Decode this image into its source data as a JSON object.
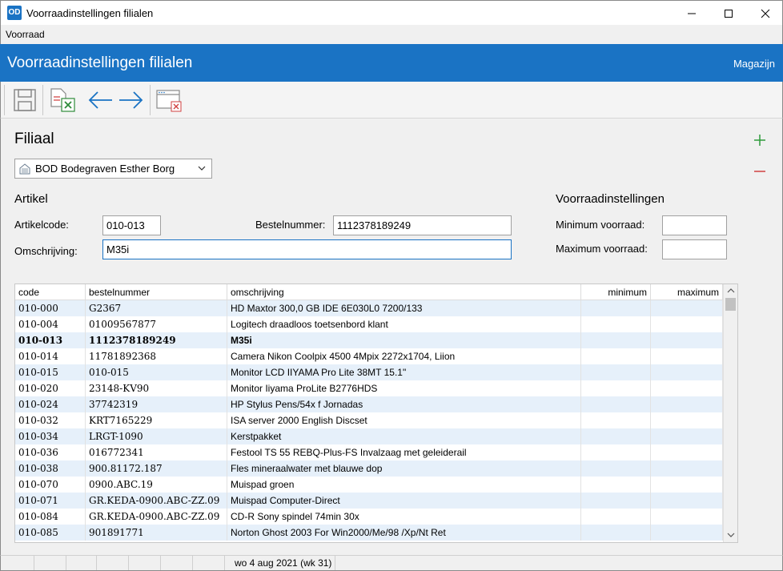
{
  "window": {
    "app_icon_text": "OD",
    "title": "Voorraadinstellingen filialen"
  },
  "menu": {
    "items": [
      "Voorraad"
    ]
  },
  "header": {
    "title": "Voorraadinstellingen filialen",
    "right_link": "Magazijn",
    "color": "#1a73c4"
  },
  "toolbar": {
    "buttons": [
      "save-icon",
      "export-excel-icon",
      "back-arrow-icon",
      "forward-arrow-icon",
      "close-window-icon"
    ]
  },
  "filiaal": {
    "title": "Filiaal",
    "selected": "BOD Bodegraven Esther Borg"
  },
  "artikel": {
    "title": "Artikel",
    "code_label": "Artikelcode:",
    "code_value": "010-013",
    "bestel_label": "Bestelnummer:",
    "bestel_value": "1112378189249",
    "oms_label": "Omschrijving:",
    "oms_value": "M35i"
  },
  "voorraad": {
    "title": "Voorraadinstellingen",
    "min_label": "Minimum voorraad:",
    "min_value": "",
    "max_label": "Maximum voorraad:",
    "max_value": ""
  },
  "grid": {
    "columns": [
      "code",
      "bestelnummer",
      "omschrijving",
      "minimum",
      "maximum"
    ],
    "rows": [
      {
        "code": "010-000",
        "best": "G2367",
        "oms": "HD Maxtor 300,0 GB IDE 6E030L0 7200/133",
        "min": "",
        "max": ""
      },
      {
        "code": "010-004",
        "best": "01009567877",
        "oms": "Logitech draadloos toetsenbord klant",
        "min": "",
        "max": ""
      },
      {
        "code": "010-013",
        "best": "1112378189249",
        "oms": "M35i",
        "min": "",
        "max": "",
        "selected": true
      },
      {
        "code": "010-014",
        "best": "11781892368",
        "oms": "Camera Nikon Coolpix 4500 4Mpix 2272x1704, Liion",
        "min": "",
        "max": ""
      },
      {
        "code": "010-015",
        "best": "010-015",
        "oms": "Monitor LCD IIYAMA Pro Lite 38MT 15.1\"",
        "min": "",
        "max": ""
      },
      {
        "code": "010-020",
        "best": "23148-KV90",
        "oms": "Monitor Iiyama ProLite B2776HDS",
        "min": "",
        "max": ""
      },
      {
        "code": "010-024",
        "best": "37742319",
        "oms": "HP Stylus Pens/54x f Jornadas",
        "min": "",
        "max": ""
      },
      {
        "code": "010-032",
        "best": "KRT7165229",
        "oms": "ISA server 2000 English Discset",
        "min": "",
        "max": ""
      },
      {
        "code": "010-034",
        "best": "LRGT-1090",
        "oms": "Kerstpakket",
        "min": "",
        "max": ""
      },
      {
        "code": "010-036",
        "best": "016772341",
        "oms": "Festool TS 55 REBQ-Plus-FS Invalzaag met geleiderail",
        "min": "",
        "max": ""
      },
      {
        "code": "010-038",
        "best": "900.81172.187",
        "oms": "Fles mineraalwater met blauwe dop",
        "min": "",
        "max": ""
      },
      {
        "code": "010-070",
        "best": "0900.ABC.19",
        "oms": "Muispad groen",
        "min": "",
        "max": ""
      },
      {
        "code": "010-071",
        "best": "GR.KEDA-0900.ABC-ZZ.09",
        "oms": "Muispad Computer-Direct",
        "min": "",
        "max": ""
      },
      {
        "code": "010-084",
        "best": "GR.KEDA-0900.ABC-ZZ.09",
        "oms": "CD-R Sony spindel 74min 30x",
        "min": "",
        "max": ""
      },
      {
        "code": "010-085",
        "best": "901891771",
        "oms": "Norton Ghost 2003 For Win2000/Me/98 /Xp/Nt Ret",
        "min": "",
        "max": ""
      }
    ]
  },
  "status": {
    "date": "wo 4 aug 2021 (wk 31)"
  }
}
